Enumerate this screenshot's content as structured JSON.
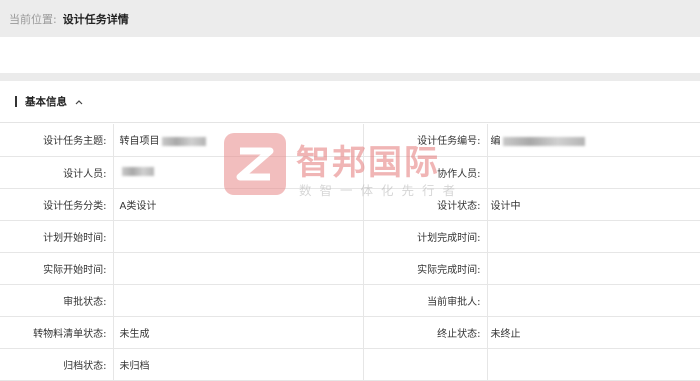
{
  "breadcrumb": {
    "prefix": "当前位置:",
    "current": "设计任务详情"
  },
  "section": {
    "title": "基本信息",
    "toggle_icon": "chevron-up-icon"
  },
  "rows": [
    {
      "l1": "设计任务主题:",
      "v1": "转自项目",
      "l2": "设计任务编号:",
      "v2": "编"
    },
    {
      "l1": "设计人员:",
      "v1": "",
      "l2": "协作人员:",
      "v2": ""
    },
    {
      "l1": "设计任务分类:",
      "v1": "A类设计",
      "l2": "设计状态:",
      "v2": "设计中"
    },
    {
      "l1": "计划开始时间:",
      "v1": "",
      "l2": "计划完成时间:",
      "v2": ""
    },
    {
      "l1": "实际开始时间:",
      "v1": "",
      "l2": "实际完成时间:",
      "v2": ""
    },
    {
      "l1": "审批状态:",
      "v1": "",
      "l2": "当前审批人:",
      "v2": ""
    },
    {
      "l1": "转物料清单状态:",
      "v1": "未生成",
      "l2": "终止状态:",
      "v2": "未终止"
    },
    {
      "l1": "归档状态:",
      "v1": "未归档",
      "l2": "",
      "v2": ""
    }
  ],
  "watermark": {
    "main": "智邦国际",
    "sub": "数智一体化先行者",
    "logo_letter": "Z"
  },
  "colors": {
    "watermark_red": "#e57a7a",
    "breadcrumb_bg": "#ececec"
  }
}
